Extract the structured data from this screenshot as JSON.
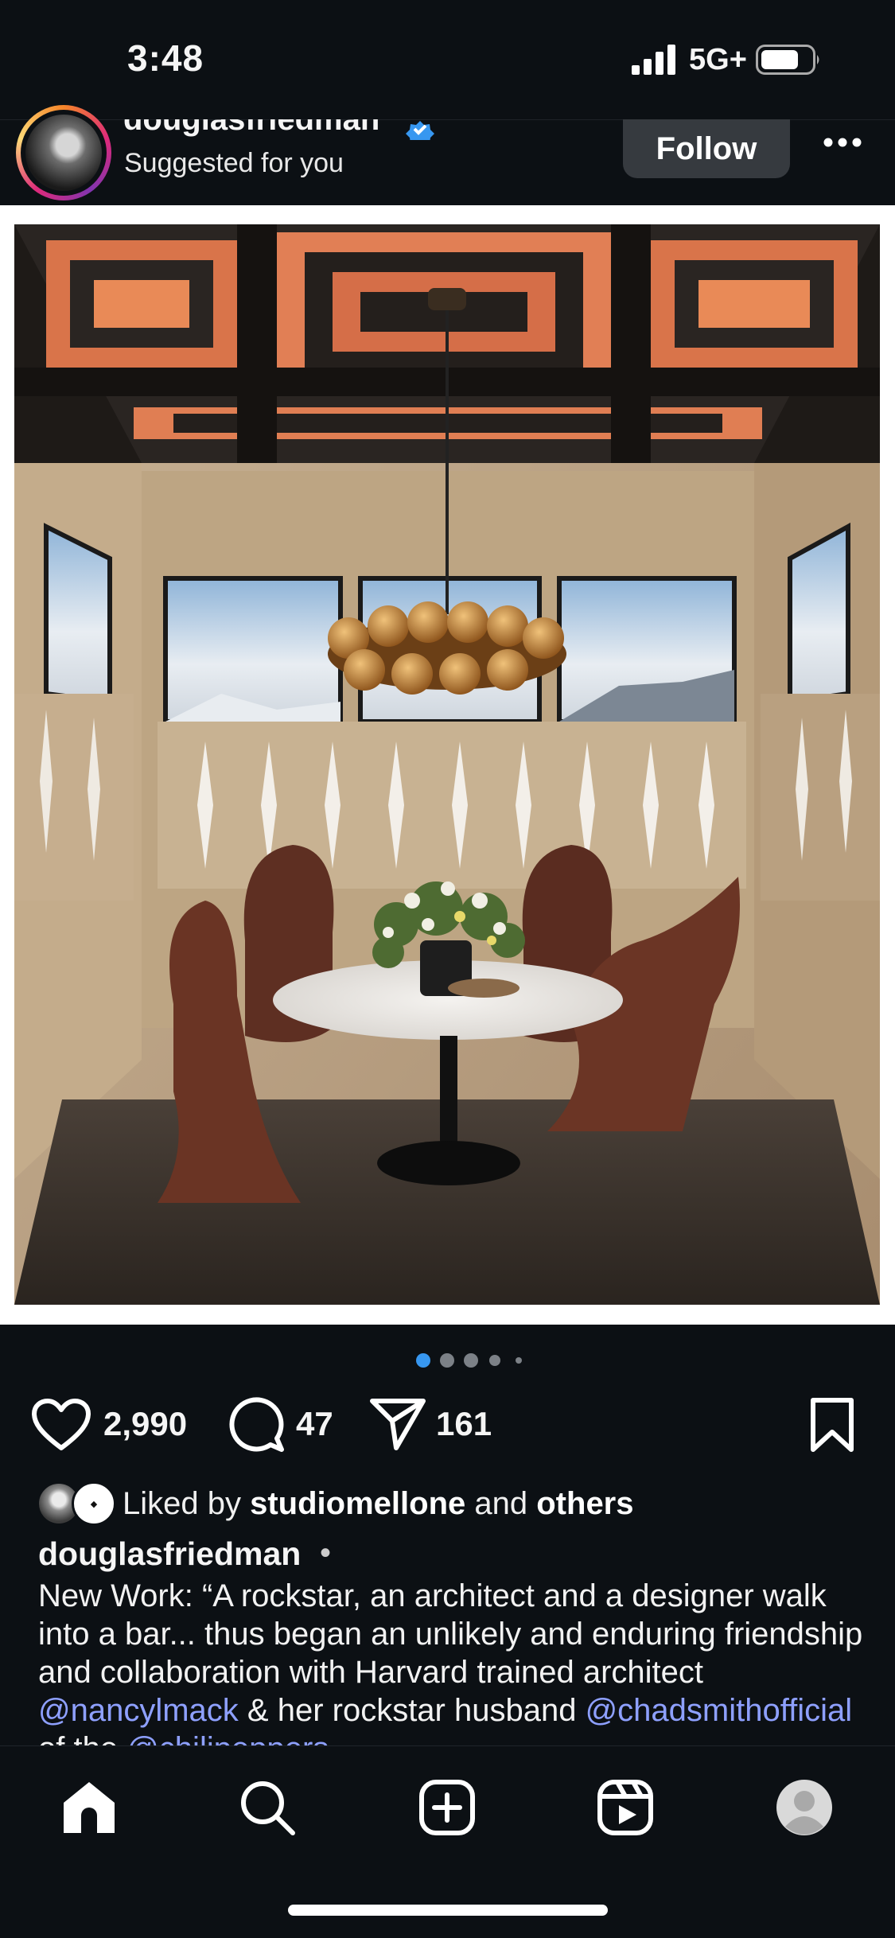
{
  "status_bar": {
    "time": "3:48",
    "network": "5G+"
  },
  "post": {
    "username": "douglasfriedman",
    "verified": true,
    "subtitle": "Suggested for you",
    "follow_label": "Follow",
    "carousel": {
      "total": 5,
      "active": 1
    },
    "actions": {
      "likes": "2,990",
      "comments": "47",
      "shares": "161"
    },
    "liked_by": {
      "prefix": "Liked by",
      "user": "studiomellone",
      "joiner": "and",
      "others": "others"
    },
    "caption_username": "douglasfriedman",
    "caption_separator": "•",
    "caption": {
      "text1": "New Work: “A rockstar, an architect and a designer walk into a bar... thus began an unlikely and enduring friendship and collaboration with Harvard trained architect ",
      "mention1": "@nancylmack",
      "text2": " & her rockstar husband ",
      "mention2": "@chadsmithofficial",
      "text3": " of the ",
      "mention3": "@chilipeppers"
    }
  },
  "colors": {
    "background": "#0c1014",
    "accent_blue": "#3797f0",
    "mention": "#8ea0ff",
    "follow_button": "#363a3f"
  },
  "tab_bar": {
    "items": [
      "home-icon",
      "search-icon",
      "create-icon",
      "reels-icon",
      "profile-icon"
    ],
    "active": "home-icon"
  }
}
